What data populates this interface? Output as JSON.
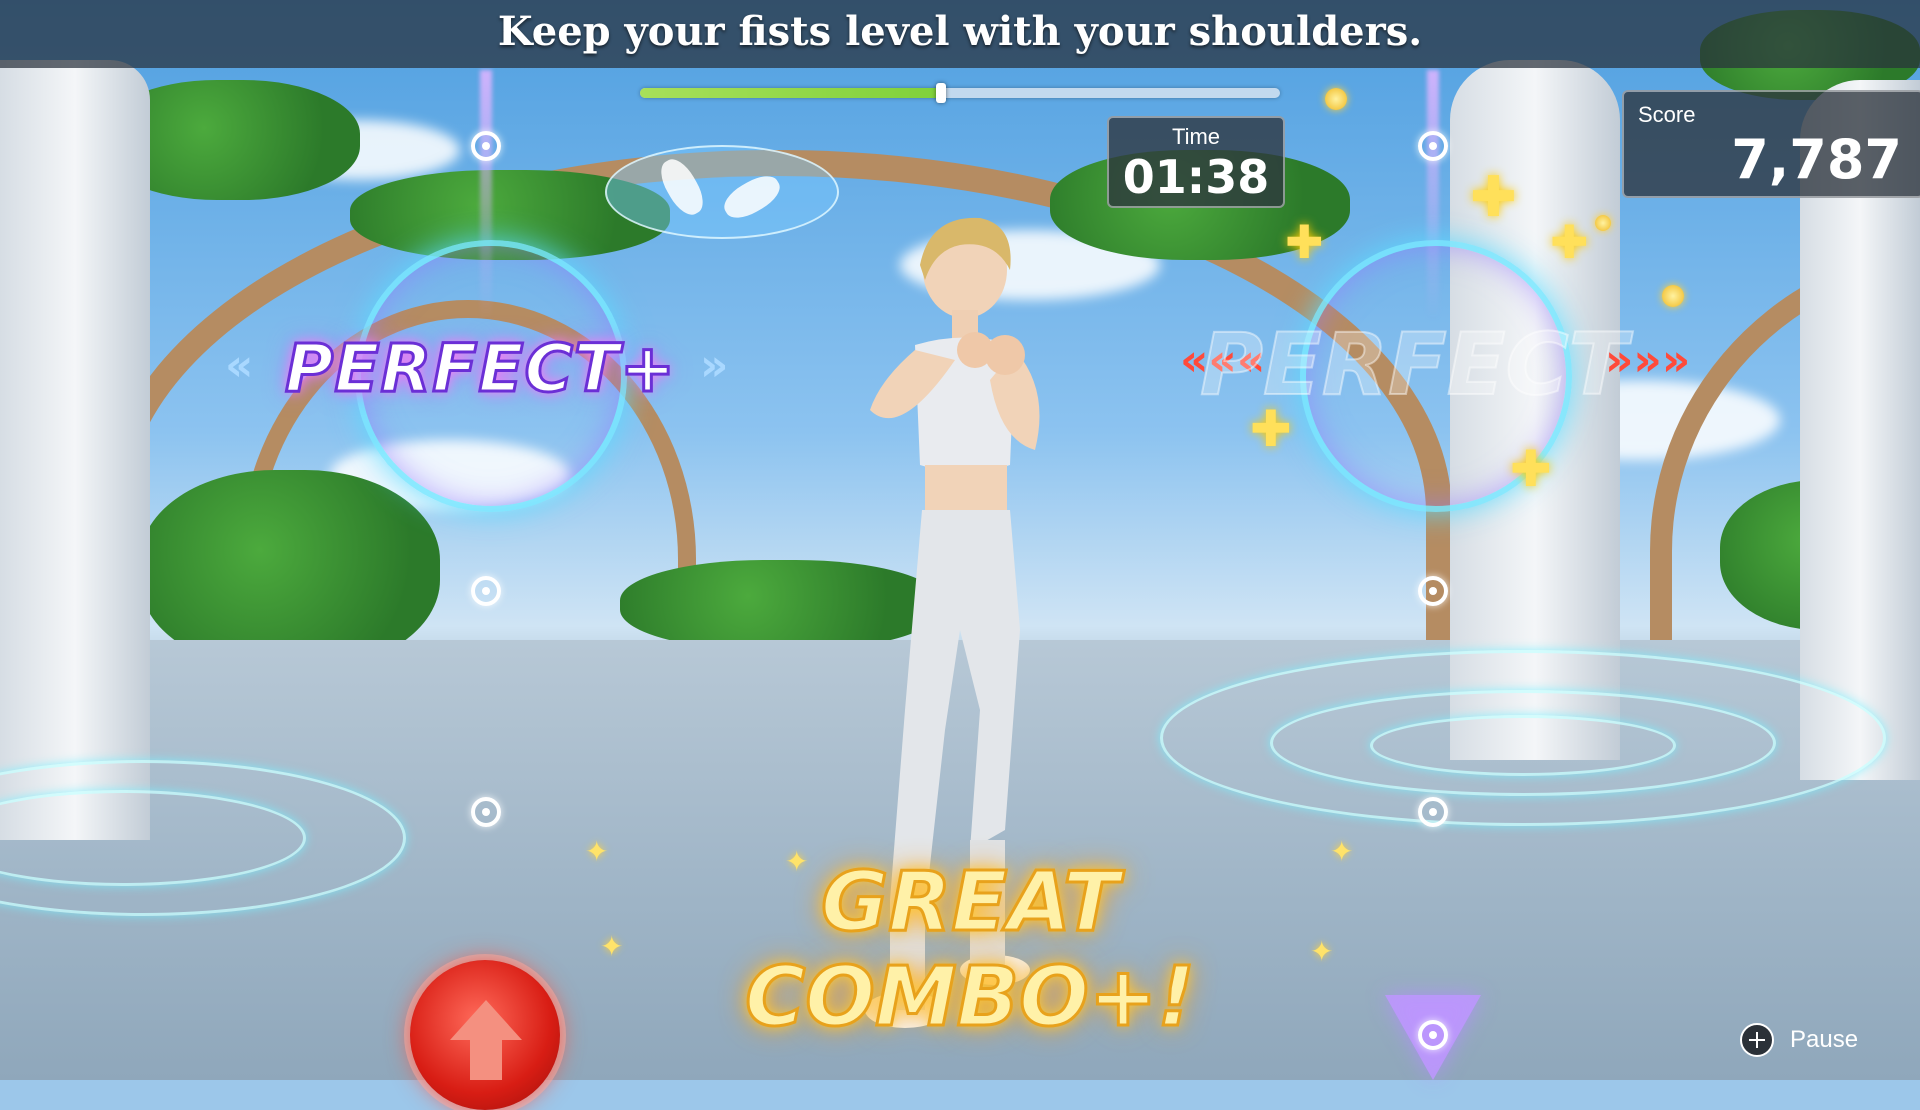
{
  "instruction": "Keep your fists level with your shoulders.",
  "progress": {
    "fraction": 0.47
  },
  "time": {
    "label": "Time",
    "value": "01:38"
  },
  "score": {
    "label": "Score",
    "value": "7,787"
  },
  "judgements": {
    "left": "PERFECT+",
    "right": "PERFECT"
  },
  "combo_text": "GREAT COMBO+!",
  "pause": {
    "label": "Pause",
    "icon": "plus-icon"
  },
  "colors": {
    "progress": "#7fd13a",
    "perfect_glow": "#b57bff",
    "combo": "#ffcc33",
    "action_button": "#d81d14"
  }
}
